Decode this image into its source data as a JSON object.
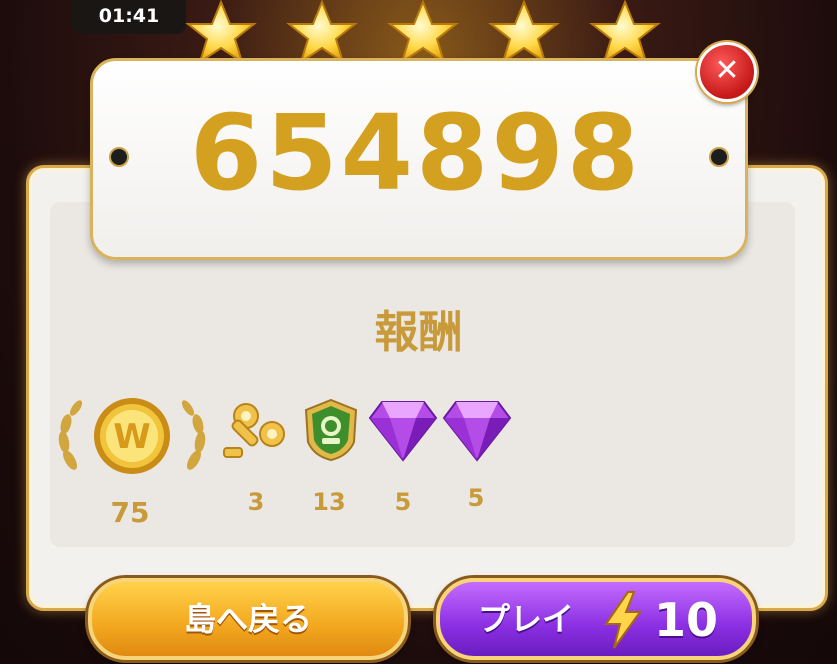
{
  "timer": "01:41",
  "stars": {
    "earned": 5,
    "total": 5
  },
  "score": "654898",
  "rewards_title": "報酬",
  "rewards": [
    {
      "icon": "gold-coin-laurel-icon",
      "count": "75"
    },
    {
      "icon": "wind-up-key-icon",
      "count": "3"
    },
    {
      "icon": "green-badge-icon",
      "count": "13"
    },
    {
      "icon": "purple-gem-icon",
      "count": "5"
    },
    {
      "icon": "purple-gem-icon",
      "count": "5"
    }
  ],
  "buttons": {
    "back_label": "島へ戻る",
    "play_label": "プレイ",
    "play_cost": "10"
  },
  "close_symbol": "✕",
  "colors": {
    "accent_gold": "#d4a020",
    "play_purple": "#8a2fe2",
    "back_orange": "#f2a71e",
    "close_red": "#c51818"
  }
}
